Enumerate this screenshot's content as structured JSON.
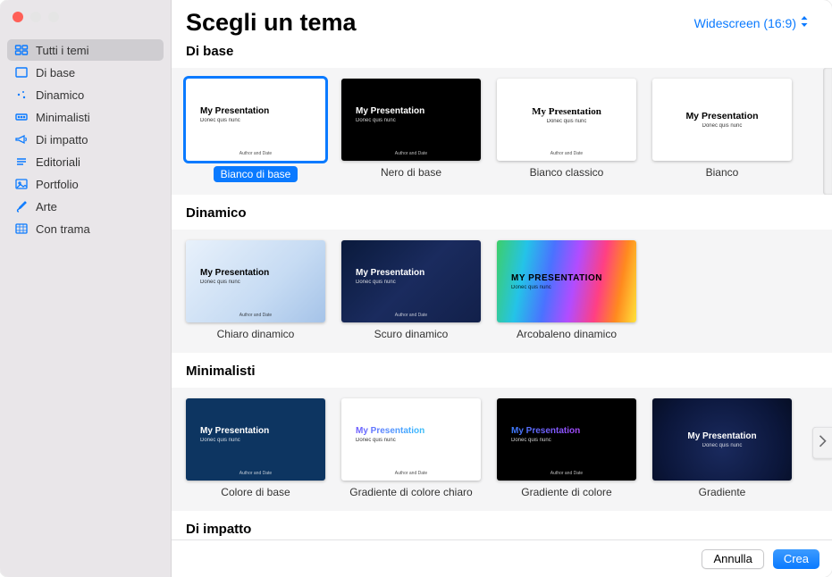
{
  "header": {
    "title": "Scegli un tema",
    "aspect_label": "Widescreen (16:9)"
  },
  "sidebar": {
    "items": [
      {
        "label": "Tutti i temi",
        "icon": "grid-icon",
        "selected": true
      },
      {
        "label": "Di base",
        "icon": "document-icon",
        "selected": false
      },
      {
        "label": "Dinamico",
        "icon": "sparkle-icon",
        "selected": false
      },
      {
        "label": "Minimalisti",
        "icon": "minimal-icon",
        "selected": false
      },
      {
        "label": "Di impatto",
        "icon": "megaphone-icon",
        "selected": false
      },
      {
        "label": "Editoriali",
        "icon": "lines-icon",
        "selected": false
      },
      {
        "label": "Portfolio",
        "icon": "image-icon",
        "selected": false
      },
      {
        "label": "Arte",
        "icon": "brush-icon",
        "selected": false
      },
      {
        "label": "Con trama",
        "icon": "texture-icon",
        "selected": false
      }
    ]
  },
  "sections": [
    {
      "title": "Di base",
      "has_peek": true,
      "themes": [
        {
          "label": "Bianco di base",
          "thumb_class": "t-white",
          "title_text": "My Presentation",
          "sub_text": "Donec quis nunc",
          "footer_text": "Author and Date",
          "selected": true
        },
        {
          "label": "Nero di base",
          "thumb_class": "t-black",
          "title_text": "My Presentation",
          "sub_text": "Donec quis nunc",
          "footer_text": "Author and Date",
          "selected": false
        },
        {
          "label": "Bianco classico",
          "thumb_class": "t-classic",
          "title_text": "My Presentation",
          "sub_text": "Donec quis nunc",
          "footer_text": "Author and Date",
          "selected": false
        },
        {
          "label": "Bianco",
          "thumb_class": "t-bianco",
          "title_text": "My Presentation",
          "sub_text": "Donec quis nunc",
          "footer_text": "",
          "selected": false
        }
      ]
    },
    {
      "title": "Dinamico",
      "has_peek": false,
      "themes": [
        {
          "label": "Chiaro dinamico",
          "thumb_class": "t-dyn-light",
          "title_text": "My Presentation",
          "sub_text": "Donec quis nunc",
          "footer_text": "Author and Date",
          "selected": false
        },
        {
          "label": "Scuro dinamico",
          "thumb_class": "t-dyn-dark",
          "title_text": "My Presentation",
          "sub_text": "Donec quis nunc",
          "footer_text": "Author and Date",
          "selected": false
        },
        {
          "label": "Arcobaleno dinamico",
          "thumb_class": "t-dyn-rainbow",
          "title_text": "MY PRESENTATION",
          "sub_text": "Donec quis nunc",
          "footer_text": "",
          "selected": false
        }
      ]
    },
    {
      "title": "Minimalisti",
      "has_arrow": true,
      "themes": [
        {
          "label": "Colore di base",
          "thumb_class": "t-basecolor",
          "title_text": "My Presentation",
          "sub_text": "Donec quis nunc",
          "footer_text": "Author and Date",
          "selected": false
        },
        {
          "label": "Gradiente di colore chiaro",
          "thumb_class": "t-grad-light",
          "title_text": "My Presentation",
          "sub_text": "Donec quis nunc",
          "footer_text": "Author and Date",
          "selected": false
        },
        {
          "label": "Gradiente di colore",
          "thumb_class": "t-grad-color",
          "title_text": "My Presentation",
          "sub_text": "Donec quis nunc",
          "footer_text": "Author and Date",
          "selected": false
        },
        {
          "label": "Gradiente",
          "thumb_class": "t-gradient",
          "title_text": "My Presentation",
          "sub_text": "Donec quis nunc",
          "footer_text": "",
          "selected": false
        }
      ]
    },
    {
      "title": "Di impatto",
      "has_peek": false,
      "themes": []
    }
  ],
  "footer": {
    "cancel": "Annulla",
    "create": "Crea"
  }
}
